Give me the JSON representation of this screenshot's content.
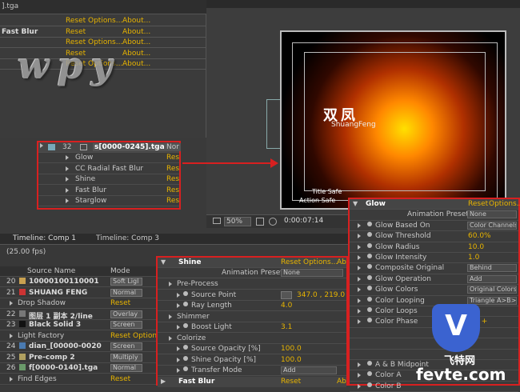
{
  "effect_controls": {
    "file_label": "].tga",
    "rows": [
      {
        "name": "",
        "reset": "Reset",
        "options": "Options...",
        "about": "About..."
      },
      {
        "name": "Fast Blur",
        "reset": "Reset",
        "options": "",
        "about": "About..."
      },
      {
        "name": "",
        "reset": "Reset",
        "options": "Options...",
        "about": "About..."
      },
      {
        "name": "",
        "reset": "Reset",
        "options": "",
        "about": "About..."
      },
      {
        "name": "",
        "reset": "Reset",
        "options": "Options...",
        "about": "About..."
      }
    ],
    "watermark_logo": "wpy"
  },
  "layer_box": {
    "layer_num": "32",
    "layer_name": "s[0000-0245].tga",
    "mode": "Nor",
    "effects": [
      {
        "name": "Glow",
        "reset": "Res"
      },
      {
        "name": "CC Radial Fast Blur",
        "reset": "Res"
      },
      {
        "name": "Shine",
        "reset": "Res"
      },
      {
        "name": "Fast Blur",
        "reset": "Res"
      },
      {
        "name": "Starglow",
        "reset": "Res"
      }
    ]
  },
  "comp_viewer": {
    "title": "双凤",
    "subtitle": "ShuangFeng",
    "title_safe": "Title Safe",
    "action_safe": "Action Safe",
    "zoom": "50%",
    "timecode": "0:00:07:14"
  },
  "timeline": {
    "tabs": [
      "Timeline: Comp 1",
      "Timeline: Comp 3"
    ],
    "fps": "(25.00 fps)",
    "headers": {
      "source": "Source Name",
      "mode": "Mode"
    },
    "rows": [
      {
        "num": "20",
        "name": "10000100110001",
        "mode": "Soft Ligl",
        "color": "#c8a050",
        "type": "layer"
      },
      {
        "num": "21",
        "name": "SHUANG FENG",
        "mode": "Normal",
        "color": "#cc3333",
        "type": "layer"
      },
      {
        "num": "",
        "name": "Drop Shadow",
        "mode": "",
        "reset": "Reset",
        "type": "effect"
      },
      {
        "num": "22",
        "name": "图层 1 副本 2/line",
        "mode": "Overlay",
        "color": "#777777",
        "type": "layer"
      },
      {
        "num": "23",
        "name": "Black Solid 3",
        "mode": "Screen",
        "color": "#111111",
        "type": "layer"
      },
      {
        "num": "",
        "name": "Light Factory",
        "mode": "",
        "reset": "Reset",
        "options": "Option",
        "type": "effect"
      },
      {
        "num": "24",
        "name": "dian_[00000-0020",
        "mode": "Screen",
        "color": "#4a7ab0",
        "type": "layer"
      },
      {
        "num": "25",
        "name": "Pre-comp 2",
        "mode": "Multiply",
        "color": "#b0a060",
        "type": "layer"
      },
      {
        "num": "26",
        "name": "f[0000-0140].tga",
        "mode": "Normal",
        "color": "#6a9a6a",
        "type": "layer"
      },
      {
        "num": "",
        "name": "Find Edges",
        "mode": "",
        "reset": "Reset",
        "type": "effect"
      }
    ]
  },
  "shine": {
    "header": {
      "name": "Shine",
      "reset": "Reset",
      "options": "Options...",
      "about": "Ab"
    },
    "presets_label": "Animation Presets:",
    "presets_value": "None",
    "rows": [
      {
        "label": "Pre-Process",
        "value": "",
        "indent": 1
      },
      {
        "label": "Source Point",
        "value": "347.0 , 219.0",
        "indent": 2
      },
      {
        "label": "Ray Length",
        "value": "4.0",
        "indent": 2
      },
      {
        "label": "Shimmer",
        "value": "",
        "indent": 1
      },
      {
        "label": "Boost Light",
        "value": "3.1",
        "indent": 2
      },
      {
        "label": "Colorize",
        "value": "",
        "indent": 1
      },
      {
        "label": "Source Opacity [%]",
        "value": "100.0",
        "indent": 2
      },
      {
        "label": "Shine Opacity [%]",
        "value": "100.0",
        "indent": 2
      },
      {
        "label": "Transfer Mode",
        "value": "Add",
        "indent": 2
      }
    ],
    "footer": {
      "name": "Fast Blur",
      "reset": "Reset",
      "about": "Ab"
    }
  },
  "glow": {
    "header": {
      "name": "Glow",
      "reset": "Reset",
      "options": "Options..."
    },
    "presets_label": "Animation Presets:",
    "presets_value": "None",
    "rows": [
      {
        "label": "Glow Based On",
        "value": "Color Channels",
        "kind": "dd"
      },
      {
        "label": "Glow Threshold",
        "value": "60.0%",
        "kind": "num"
      },
      {
        "label": "Glow Radius",
        "value": "10.0",
        "kind": "num"
      },
      {
        "label": "Glow Intensity",
        "value": "1.0",
        "kind": "num"
      },
      {
        "label": "Composite Original",
        "value": "Behind",
        "kind": "dd"
      },
      {
        "label": "Glow Operation",
        "value": "Add",
        "kind": "dd"
      },
      {
        "label": "Glow Colors",
        "value": "Original Colors",
        "kind": "dd"
      },
      {
        "label": "Color Looping",
        "value": "Triangle A>B>A",
        "kind": "dd"
      },
      {
        "label": "Color Loops",
        "value": "1.0",
        "kind": "num"
      },
      {
        "label": "Color Phase",
        "value": "0 x +",
        "kind": "num"
      },
      {
        "label": "",
        "value": "",
        "kind": "blank"
      },
      {
        "label": "",
        "value": "",
        "kind": "blank"
      },
      {
        "label": "",
        "value": "",
        "kind": "blank"
      },
      {
        "label": "A & B Midpoint",
        "value": "",
        "kind": "num"
      },
      {
        "label": "Color A",
        "value": "",
        "kind": "num"
      },
      {
        "label": "Color B",
        "value": "",
        "kind": "num"
      }
    ]
  },
  "watermark": {
    "glyph": "V",
    "cn": "飞特网",
    "en": "fevte.com"
  }
}
